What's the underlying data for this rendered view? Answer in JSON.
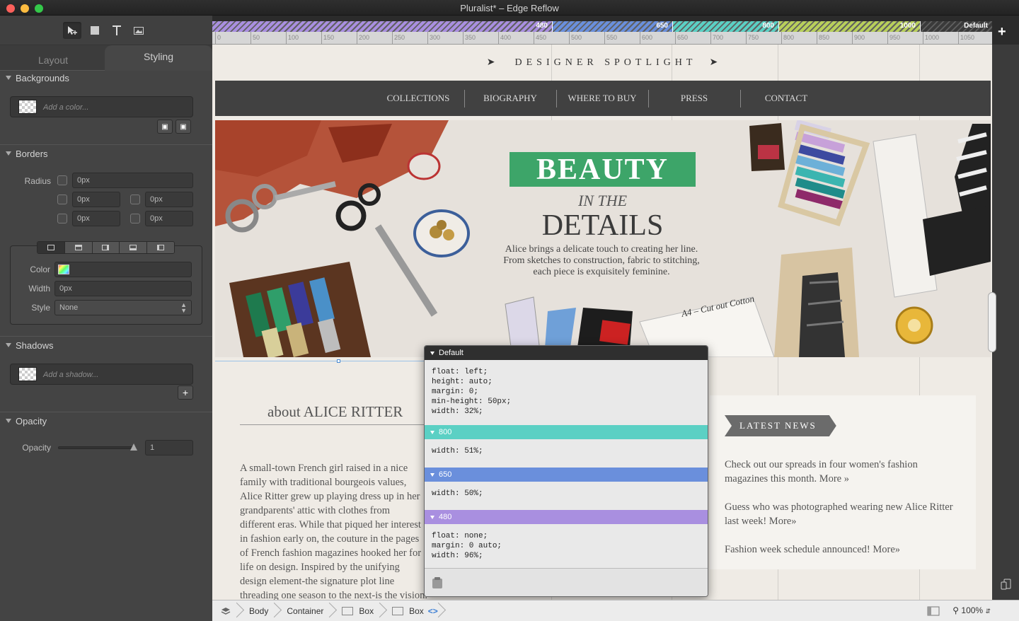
{
  "window": {
    "title": "Pluralist* – Edge Reflow"
  },
  "panel": {
    "tabs": {
      "layout": "Layout",
      "styling": "Styling"
    },
    "backgrounds": {
      "title": "Backgrounds",
      "placeholder": "Add a color..."
    },
    "borders": {
      "title": "Borders",
      "radius_label": "Radius",
      "radius_all": "0px",
      "radius_corners": [
        "0px",
        "0px",
        "0px",
        "0px"
      ],
      "color_label": "Color",
      "width_label": "Width",
      "width_value": "0px",
      "style_label": "Style",
      "style_value": "None"
    },
    "shadows": {
      "title": "Shadows",
      "placeholder": "Add a shadow..."
    },
    "opacity": {
      "title": "Opacity",
      "label": "Opacity",
      "value": "1",
      "level": 1
    }
  },
  "breakpoints": [
    {
      "label": "480",
      "color": "#a98fe0"
    },
    {
      "label": "650",
      "color": "#6a8fdc"
    },
    {
      "label": "800",
      "color": "#5bd0c4"
    },
    {
      "label": "1000",
      "color": "#b8cf5b"
    },
    {
      "label": "Default",
      "color": "#3a3a3a"
    }
  ],
  "ruler_ticks": [
    "0",
    "50",
    "100",
    "150",
    "200",
    "250",
    "300",
    "350",
    "400",
    "450",
    "500",
    "550",
    "600",
    "650",
    "700",
    "750",
    "800",
    "850",
    "900",
    "950",
    "1000",
    "1050"
  ],
  "site": {
    "spotlight": "DESIGNER SPOTLIGHT",
    "nav": [
      "COLLECTIONS",
      "BIOGRAPHY",
      "WHERE TO BUY",
      "PRESS",
      "CONTACT"
    ],
    "hero": {
      "beauty": "BEAUTY",
      "in_the": "IN THE",
      "details": "DETAILS",
      "text": "Alice brings a delicate touch to creating her line. From sketches to construction, fabric to stitching, each piece is exquisitely feminine.",
      "note": "A4 – Cut out Cotton"
    },
    "about": {
      "title": "about ALICE RITTER",
      "text": "A small-town French girl raised in a nice family with traditional bourgeois values, Alice Ritter grew up playing dress up in her grandparents' attic with clothes from different eras. While that piqued her interest in fashion early on, the couture in the pages of French fashion magazines hooked her for life on design. Inspired by the unifying design element-the signature plot line threading one season to the next-is the vision. The story she"
    },
    "news": {
      "title": "LATEST NEWS",
      "items": [
        "Check out our spreads in four women's fashion magazines this month.  More »",
        "Guess who was photographed wearing new Alice Ritter last week! More»",
        "Fashion week schedule announced! More»"
      ]
    }
  },
  "css_popup": {
    "sections": [
      {
        "name": "Default",
        "code": "float: left;\nheight: auto;\nmargin: 0;\nmin-height: 50px;\nwidth: 32%;",
        "color": "#2f2f2f"
      },
      {
        "name": "800",
        "code": "width: 51%;",
        "color": "#5bd0c4"
      },
      {
        "name": "650",
        "code": "width: 50%;",
        "color": "#6a8fdc"
      },
      {
        "name": "480",
        "code": "float: none;\nmargin: 0 auto;\nwidth: 96%;",
        "color": "#a98fe0"
      }
    ]
  },
  "breadcrumbs": [
    "Body",
    "Container",
    "Box",
    "Box"
  ],
  "zoom": "100%"
}
